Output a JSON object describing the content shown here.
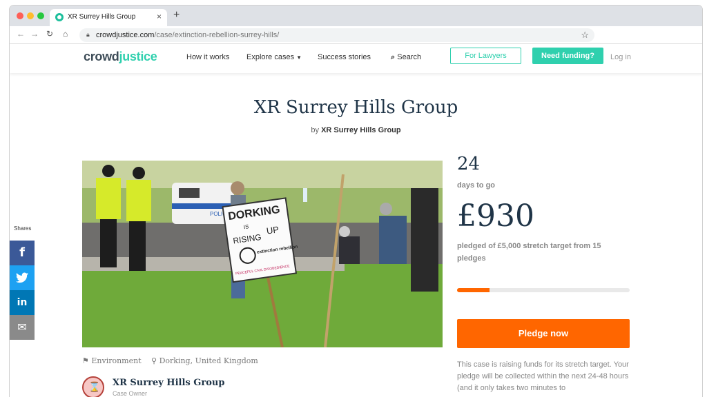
{
  "browser": {
    "tab_title": "XR Surrey Hills Group",
    "tab_close": "×",
    "new_tab": "+",
    "url_domain": "crowdjustice.com",
    "url_path": "/case/extinction-rebellion-surrey-hills/"
  },
  "site": {
    "logo_part1": "crowd",
    "logo_part2": "justice",
    "nav": {
      "how": "How it works",
      "explore": "Explore cases",
      "success": "Success stories",
      "search": "Search"
    },
    "for_lawyers": "For Lawyers",
    "need_funding": "Need funding?",
    "login": "Log in"
  },
  "case": {
    "title": "XR Surrey Hills Group",
    "by_prefix": "by",
    "by_name": "XR Surrey Hills Group",
    "days_count": "24",
    "days_label": "days to go",
    "amount": "£930",
    "pledged_text": "pledged of £5,000 stretch target from 15 pledges",
    "progress_fraction": 0.186,
    "pledge_button": "Pledge now",
    "info_text": "This case is raising funds for its stretch target. Your pledge will be collected within the next 24-48 hours (and it only takes two minutes to",
    "category": "Environment",
    "location": "Dorking, United Kingdom",
    "owner_name": "XR Surrey Hills Group",
    "owner_role": "Case Owner"
  },
  "photo": {
    "sign_line1": "DORKING",
    "sign_line2": "IS",
    "sign_line3": "RISING",
    "sign_line4": "UP",
    "sign_line5": "extinction rebellion",
    "sign_line6": "PEACEFUL CIVIL DISOBEDIENCE",
    "van_text": "POLICE"
  },
  "shares": {
    "label": "Shares",
    "facebook": "f",
    "linkedin": "in",
    "email": "✉"
  },
  "colors": {
    "brand_teal": "#2fd0ae",
    "accent_orange": "#ff6600",
    "heading_navy": "#1f3447"
  }
}
